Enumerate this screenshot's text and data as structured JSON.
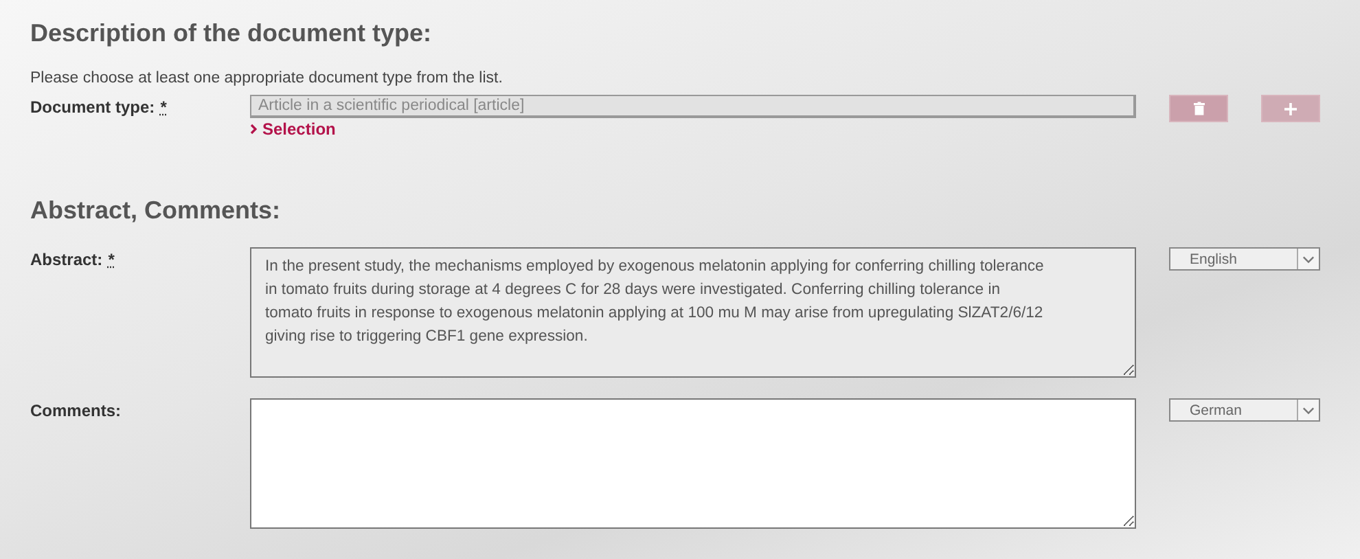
{
  "sections": [
    {
      "heading": "Description of the document type:",
      "hint": "Please choose at least one appropriate document type from the list.",
      "fields": [
        {
          "kind": "select_list",
          "label": "Document type:",
          "required_mark": "*",
          "value": "Article in a scientific periodical [article]",
          "disabled": true,
          "link": "Selection",
          "buttons": [
            {
              "kind": "delete"
            },
            {
              "kind": "add"
            }
          ]
        }
      ]
    },
    {
      "heading": "Abstract, Comments:",
      "fields": [
        {
          "kind": "textarea",
          "label": "Abstract:",
          "required_mark": "*",
          "value": "In the present study, the mechanisms employed by exogenous melatonin applying for conferring chilling tolerance\nin tomato fruits during storage at 4 degrees C for 28 days were investigated. Conferring chilling tolerance in\ntomato fruits in response to exogenous melatonin applying at 100 mu M may arise from upregulating SlZAT2/6/12\ngiving rise to triggering CBF1 gene expression.",
          "disabled": true,
          "language": "English"
        },
        {
          "kind": "textarea",
          "label": "Comments:",
          "disabled": false,
          "language": "German"
        }
      ]
    }
  ]
}
